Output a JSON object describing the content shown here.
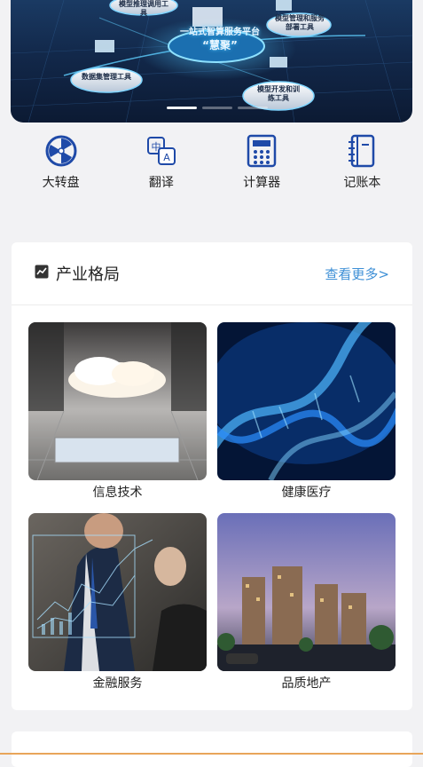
{
  "banner": {
    "center_title": "一站式智算服务平台",
    "center_subtitle": "“慧聚”",
    "labels": {
      "top_left": "模型推理调用工具",
      "top_right": "模型管理和服务部署工具",
      "left": "数据集管理工具",
      "right": "模型开发和训练工具"
    },
    "slides": 3,
    "active_slide": 1
  },
  "tools": [
    {
      "label": "大转盘",
      "icon": "wheel-icon"
    },
    {
      "label": "翻译",
      "icon": "translate-icon"
    },
    {
      "label": "计算器",
      "icon": "calculator-icon"
    },
    {
      "label": "记账本",
      "icon": "notebook-icon"
    }
  ],
  "industry": {
    "title": "产业格局",
    "title_icon": "trend-chart-icon",
    "more_label": "查看更多>",
    "items": [
      {
        "label": "信息技术",
        "image": "cloud-datacenter-image"
      },
      {
        "label": "健康医疗",
        "image": "dna-helix-image"
      },
      {
        "label": "金融服务",
        "image": "finance-chart-image"
      },
      {
        "label": "品质地产",
        "image": "real-estate-buildings-image"
      }
    ]
  },
  "colors": {
    "accent": "#3d8fd6",
    "icon_blue": "#1f4aa8",
    "background": "#f2f2f4"
  }
}
